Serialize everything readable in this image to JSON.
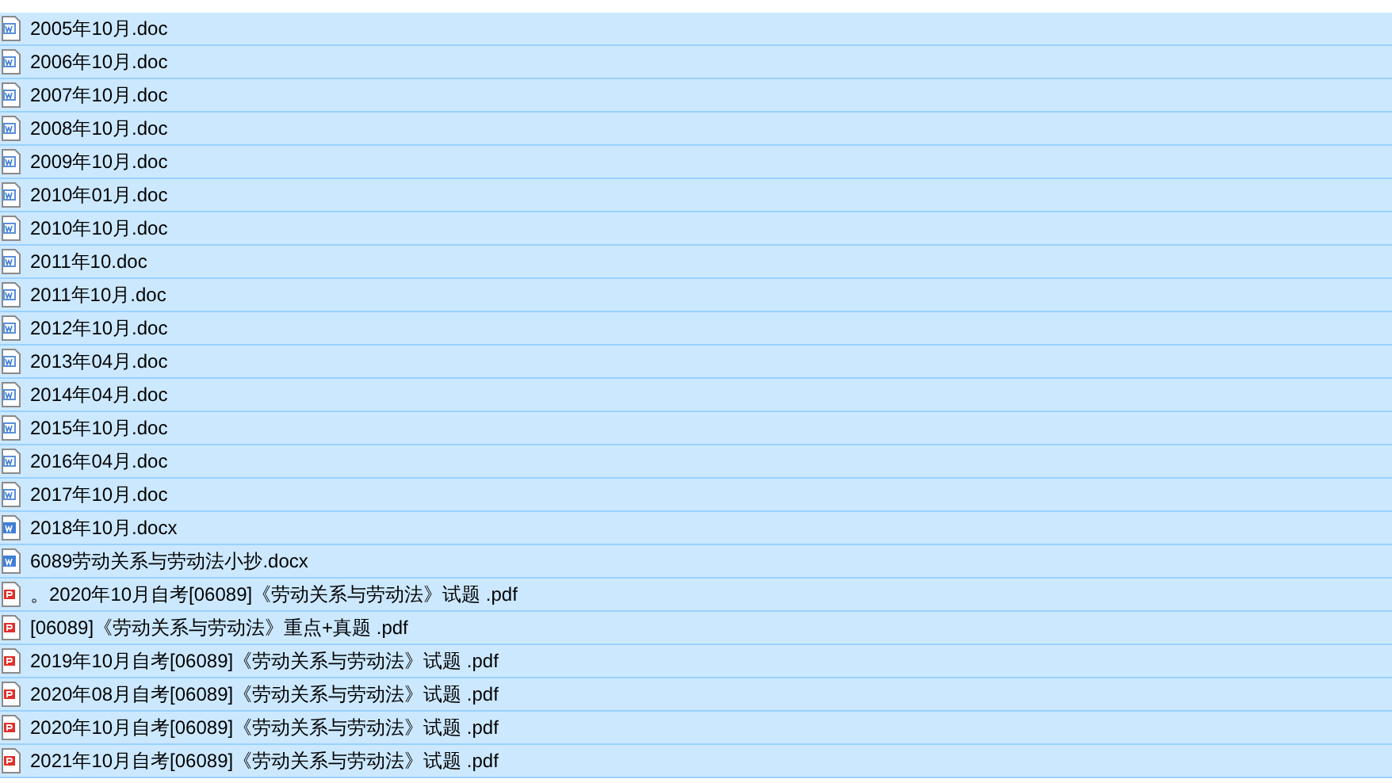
{
  "files": [
    {
      "name": "2005年10月.doc",
      "kind": "doc",
      "selected": true
    },
    {
      "name": "2006年10月.doc",
      "kind": "doc",
      "selected": true
    },
    {
      "name": "2007年10月.doc",
      "kind": "doc",
      "selected": true
    },
    {
      "name": "2008年10月.doc",
      "kind": "doc",
      "selected": true
    },
    {
      "name": "2009年10月.doc",
      "kind": "doc",
      "selected": true
    },
    {
      "name": "2010年01月.doc",
      "kind": "doc",
      "selected": true
    },
    {
      "name": "2010年10月.doc",
      "kind": "doc",
      "selected": true
    },
    {
      "name": "2011年10.doc",
      "kind": "doc",
      "selected": true
    },
    {
      "name": "2011年10月.doc",
      "kind": "doc",
      "selected": true
    },
    {
      "name": "2012年10月.doc",
      "kind": "doc",
      "selected": true
    },
    {
      "name": "2013年04月.doc",
      "kind": "doc",
      "selected": true
    },
    {
      "name": "2014年04月.doc",
      "kind": "doc",
      "selected": true
    },
    {
      "name": "2015年10月.doc",
      "kind": "doc",
      "selected": true
    },
    {
      "name": "2016年04月.doc",
      "kind": "doc",
      "selected": true
    },
    {
      "name": "2017年10月.doc",
      "kind": "doc",
      "selected": true
    },
    {
      "name": "2018年10月.docx",
      "kind": "docx",
      "selected": true
    },
    {
      "name": "6089劳动关系与劳动法小抄.docx",
      "kind": "docx",
      "selected": true
    },
    {
      "name": "。2020年10月自考[06089]《劳动关系与劳动法》试题 .pdf",
      "kind": "pdf",
      "selected": true
    },
    {
      "name": "[06089]《劳动关系与劳动法》重点+真题 .pdf",
      "kind": "pdf",
      "selected": true
    },
    {
      "name": "2019年10月自考[06089]《劳动关系与劳动法》试题 .pdf",
      "kind": "pdf",
      "selected": true
    },
    {
      "name": "2020年08月自考[06089]《劳动关系与劳动法》试题 .pdf",
      "kind": "pdf",
      "selected": true
    },
    {
      "name": "2020年10月自考[06089]《劳动关系与劳动法》试题 .pdf",
      "kind": "pdf",
      "selected": true
    },
    {
      "name": "2021年10月自考[06089]《劳动关系与劳动法》试题 .pdf",
      "kind": "pdf",
      "selected": true
    }
  ]
}
